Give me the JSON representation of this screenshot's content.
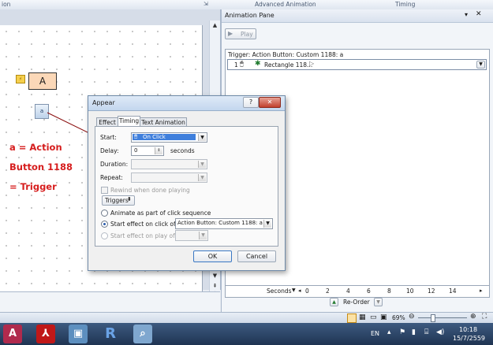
{
  "ribbon": {
    "group_advanced": "Advanced Animation",
    "group_timing": "Timing"
  },
  "slide": {
    "shape_label": "A",
    "trigger_button_label": "a",
    "annotation_lines": [
      "a = Action",
      "Button 1188",
      "= Trigger"
    ]
  },
  "animation_pane": {
    "title": "Animation Pane",
    "play_label": "Play",
    "trigger_header": "Trigger: Action Button: Custom 1188: a",
    "item_number": "1",
    "item_label": "Rectangle 118...",
    "seconds_label": "Seconds",
    "timeline_ticks": [
      "0",
      "2",
      "4",
      "6",
      "8",
      "10",
      "12",
      "14"
    ],
    "reorder_label": "Re-Order"
  },
  "dialog": {
    "title": "Appear",
    "tabs": [
      "Effect",
      "Timing",
      "Text Animation"
    ],
    "active_tab": "Timing",
    "start_label": "Start:",
    "start_value": "On Click",
    "delay_label": "Delay:",
    "delay_value": "0",
    "delay_unit": "seconds",
    "duration_label": "Duration:",
    "repeat_label": "Repeat:",
    "rewind_label": "Rewind when done playing",
    "triggers_button": "Triggers",
    "option_sequence": "Animate as part of click sequence",
    "option_click_of": "Start effect on click of:",
    "click_of_value": "Action Button: Custom 1188: a",
    "option_play_of": "Start effect on play of:",
    "ok": "OK",
    "cancel": "Cancel"
  },
  "status_bar": {
    "zoom": "69%"
  },
  "taskbar": {
    "apps": [
      "access-icon",
      "acrobat-icon",
      "photo-viewer-icon",
      "r-icon",
      "search-app-icon"
    ],
    "language": "EN",
    "time": "10:18",
    "date": "15/7/2559"
  },
  "colors": {
    "accent_red": "#d61d1d",
    "selection_blue": "#3f7fdc",
    "shape_fill": "#fbd8b8"
  }
}
